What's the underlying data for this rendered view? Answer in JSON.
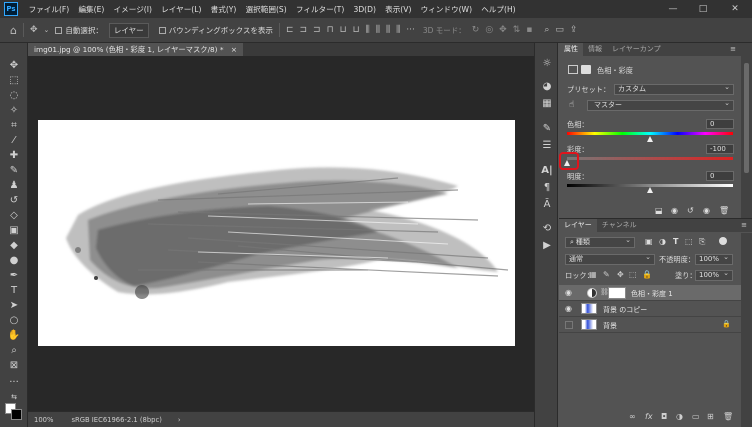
{
  "menu": {
    "logo": "Ps",
    "items": [
      "ファイル(F)",
      "編集(E)",
      "イメージ(I)",
      "レイヤー(L)",
      "書式(Y)",
      "選択範囲(S)",
      "フィルター(T)",
      "3D(D)",
      "表示(V)",
      "ウィンドウ(W)",
      "ヘルプ(H)"
    ],
    "minimize": "—",
    "maximize": "□",
    "close": "✕"
  },
  "options": {
    "auto_select_label": "自動選択：",
    "auto_select_value": "レイヤー",
    "bounding_box_label": "バウンディングボックスを表示",
    "mode_3d": "3D モード："
  },
  "document": {
    "tab_title": "img01.jpg @ 100% (色相・彩度 1, レイヤーマスク/8) *",
    "tab_close": "×",
    "zoom": "100%",
    "color_profile": "sRGB IEC61966-2.1 (8bpc)",
    "status_arrow": "›"
  },
  "properties": {
    "tabs": [
      "属性",
      "情報",
      "レイヤーカンプ"
    ],
    "header": "色相・彩度",
    "preset_label": "プリセット：",
    "preset_value": "カスタム",
    "channel_value": "マスター",
    "hue_label": "色相：",
    "hue_value": "0",
    "hue_level": 0.5,
    "saturation_label": "彩度：",
    "saturation_value": "-100",
    "saturation_level": 0.0,
    "lightness_label": "明度：",
    "lightness_value": "0",
    "lightness_level": 0.5
  },
  "layers": {
    "tabs": [
      "レイヤー",
      "チャンネル"
    ],
    "filter_value": "種類",
    "blend_mode": "通常",
    "opacity_label": "不透明度：",
    "opacity_value": "100%",
    "lock_label": "ロック：",
    "fill_label": "塗り：",
    "fill_value": "100%",
    "items": [
      {
        "name": "色相・彩度 1"
      },
      {
        "name": "背景 のコピー"
      },
      {
        "name": "背景"
      }
    ]
  },
  "colors": {
    "highlight": "#e0141c",
    "accent": "#31a8ff"
  }
}
